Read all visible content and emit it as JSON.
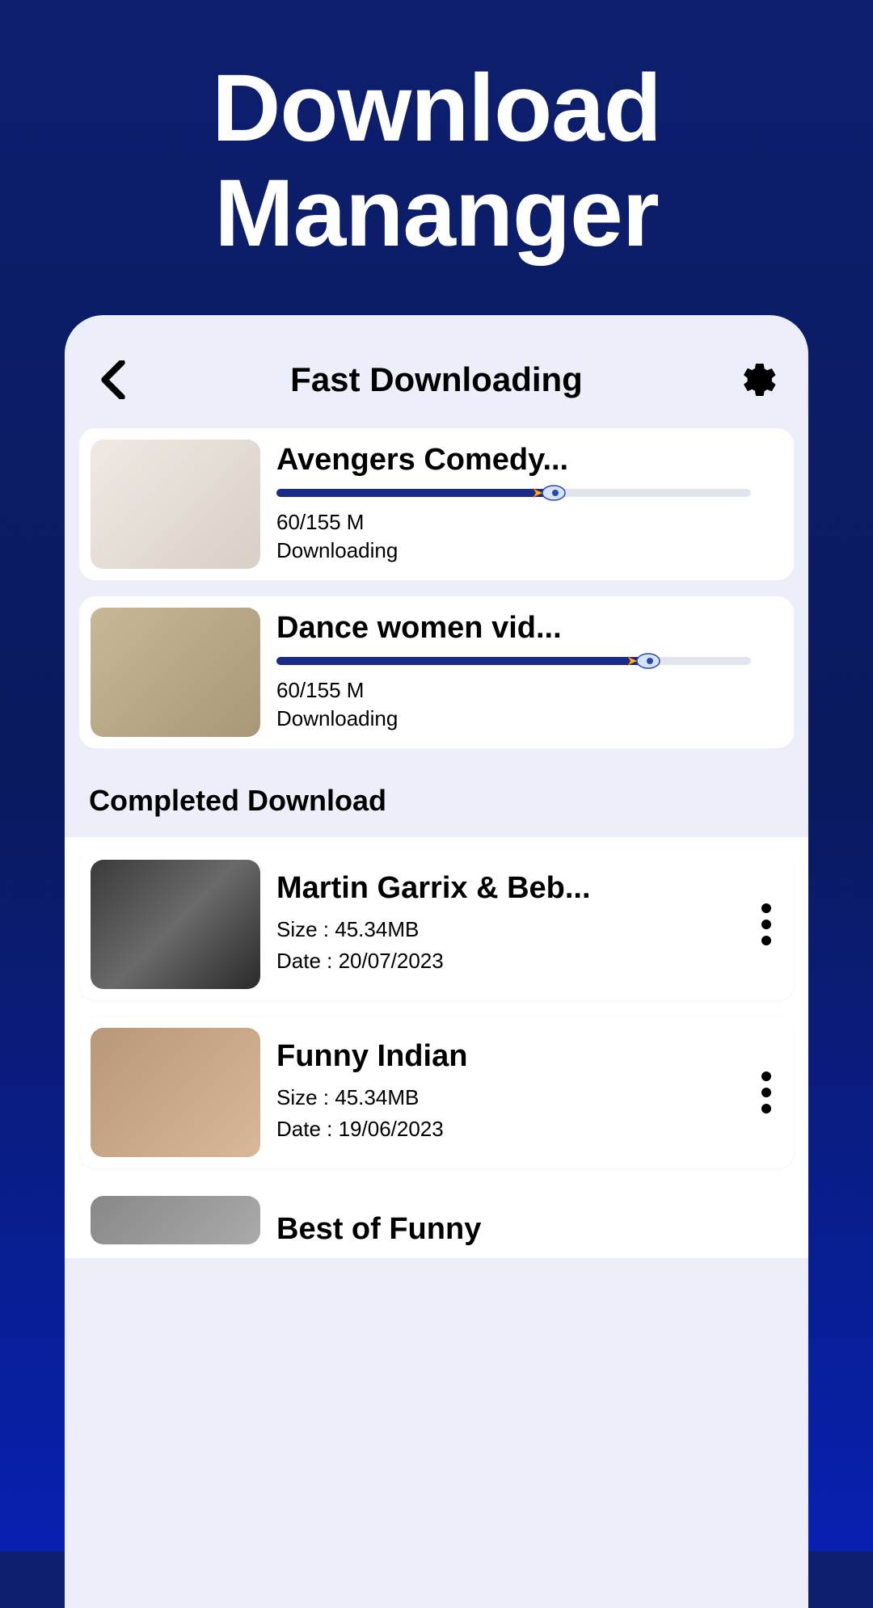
{
  "promo": {
    "line1": "Download",
    "line2": "Mananger"
  },
  "header": {
    "title": "Fast Downloading"
  },
  "downloading": [
    {
      "title": "Avengers Comedy...",
      "progress_pct": 58,
      "progress_text": "60/155 M",
      "status": "Downloading"
    },
    {
      "title": "Dance women vid...",
      "progress_pct": 78,
      "progress_text": "60/155 M",
      "status": "Downloading"
    }
  ],
  "completed_section_title": "Completed Download",
  "completed": [
    {
      "title": "Martin Garrix & Beb...",
      "size_label": "Size : 45.34MB",
      "date_label": "Date : 20/07/2023"
    },
    {
      "title": "Funny Indian",
      "size_label": "Size : 45.34MB",
      "date_label": "Date : 19/06/2023"
    }
  ],
  "partial": {
    "title": "Best of Funny"
  }
}
